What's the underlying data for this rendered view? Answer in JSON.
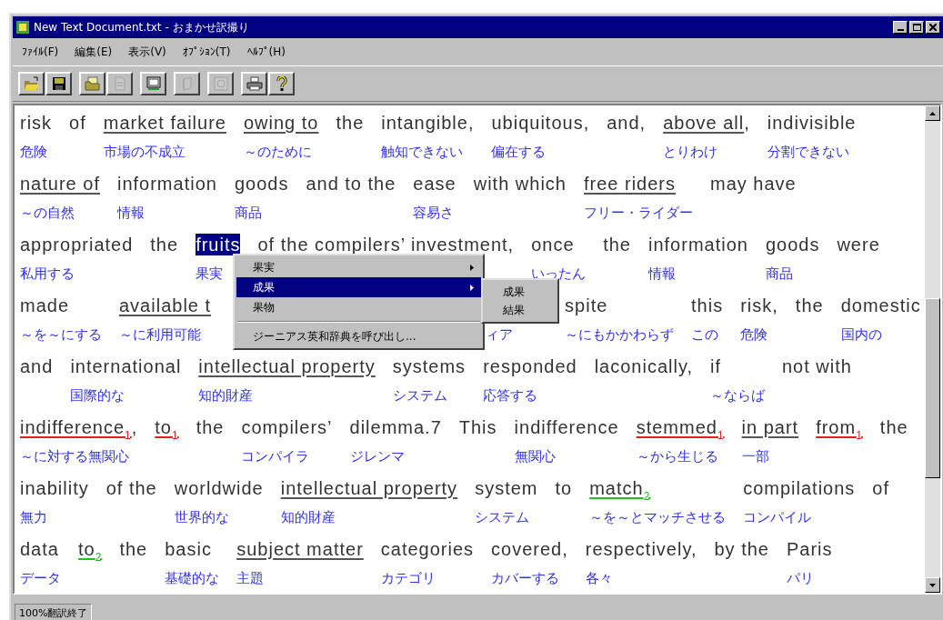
{
  "window": {
    "title": "New Text Document.txt - おまかせ訳撮り"
  },
  "menu": [
    "ﾌｧｲﾙ(F)",
    "編集(E)",
    "表示(V)",
    "ｵﾌﾟｼｮﾝ(T)",
    "ﾍﾙﾌﾟ(H)"
  ],
  "toolbar": [
    [
      {
        "kind": "open",
        "disabled": false
      },
      {
        "kind": "save",
        "disabled": false
      }
    ],
    [
      {
        "kind": "folder",
        "disabled": false
      },
      {
        "kind": "document",
        "disabled": true
      }
    ],
    [
      {
        "kind": "monitor",
        "disabled": false
      }
    ],
    [
      {
        "kind": "book",
        "disabled": true
      }
    ],
    [
      {
        "kind": "disc",
        "disabled": true
      }
    ],
    [
      {
        "kind": "printer",
        "disabled": false
      },
      {
        "kind": "help",
        "disabled": false
      }
    ]
  ],
  "lines": [
    [
      {
        "text": "risk",
        "gloss": "危険"
      },
      {
        "text": "of"
      },
      {
        "text": "market failure",
        "kind": "underline",
        "gloss": "市場の不成立"
      },
      {
        "text": "owing to",
        "kind": "underline",
        "gloss": "～のために"
      },
      {
        "text": "the"
      },
      {
        "text": "intangible,",
        "gloss": "触知できない"
      },
      {
        "text": "ubiquitous,",
        "gloss": "偏在する"
      },
      {
        "text": "and,"
      },
      {
        "text": "above all",
        "kind": "underline",
        "tail": ",",
        "gloss": "とりわけ"
      },
      {
        "text": "indivisible",
        "gloss": "分割できない"
      }
    ],
    [
      {
        "text": "nature of",
        "kind": "underline",
        "gloss": "～の自然"
      },
      {
        "text": "information",
        "gloss": "情報"
      },
      {
        "text": "goods",
        "gloss": "商品"
      },
      {
        "text": "and to the"
      },
      {
        "text": "ease",
        "gloss": "容易さ"
      },
      {
        "text": "with which"
      },
      {
        "text": "free riders",
        "kind": "underline",
        "gloss": "フリー・ライダー"
      },
      {
        "text": "may have"
      }
    ],
    [
      {
        "text": "appropriated",
        "gloss": "私用する"
      },
      {
        "text": "the"
      },
      {
        "text": "fruits",
        "kind": "selected",
        "gloss": "果実"
      },
      {
        "text": "of the compilers’ investment,"
      },
      {
        "text": "once",
        "gloss": "いったん"
      },
      {
        "text": "the"
      },
      {
        "text": "information",
        "gloss": "情報"
      },
      {
        "text": "goods",
        "gloss": "商品"
      },
      {
        "text": "were"
      }
    ],
    [
      {
        "text": "made",
        "gloss": "～を～にする"
      },
      {
        "text": "available t",
        "kind": "underline",
        "gloss": "～に利用可能"
      },
      {
        "gloss": "ィア"
      },
      {
        "text": "spite",
        "gloss": "～にもかかわらず"
      },
      {
        "text": "this",
        "gloss": "この"
      },
      {
        "text": "risk,",
        "gloss": "危険"
      },
      {
        "text": "the"
      },
      {
        "text": "domestic",
        "gloss": "国内の"
      }
    ],
    [
      {
        "text": "and"
      },
      {
        "text": "international",
        "gloss": "国際的な"
      },
      {
        "text": "intellectual property",
        "kind": "underline",
        "gloss": "知的財産"
      },
      {
        "text": "systems",
        "gloss": "システム"
      },
      {
        "text": "responded",
        "gloss": "応答する"
      },
      {
        "text": "laconically,"
      },
      {
        "text": "if",
        "gloss": "～ならば"
      },
      {
        "text": "not with"
      }
    ],
    [
      {
        "text": "indifference",
        "kind": "error",
        "mark": "1",
        "tail": ",",
        "gloss": "～に対する無関心"
      },
      {
        "text": "to",
        "kind": "error",
        "mark": "1"
      },
      {
        "text": "the"
      },
      {
        "text": "compilers’",
        "gloss": "コンパイラ"
      },
      {
        "text": "dilemma.7",
        "gloss": "ジレンマ"
      },
      {
        "text": "This"
      },
      {
        "text": "indifference",
        "gloss": "無関心"
      },
      {
        "text": "stemmed",
        "kind": "error",
        "mark": "1",
        "gloss": "～から生じる"
      },
      {
        "text": "in part",
        "kind": "underline",
        "gloss": "一部"
      },
      {
        "text": "from",
        "kind": "error",
        "mark": "1"
      },
      {
        "text": "the"
      }
    ],
    [
      {
        "text": "inability",
        "gloss": "無力"
      },
      {
        "text": "of the"
      },
      {
        "text": "worldwide",
        "gloss": "世界的な"
      },
      {
        "text": "intellectual property",
        "kind": "underline",
        "gloss": "知的財産"
      },
      {
        "text": "system",
        "gloss": "システム"
      },
      {
        "text": "to"
      },
      {
        "text": "match",
        "kind": "alternative",
        "mark": "2",
        "gloss": "～を～とマッチさせる"
      },
      {
        "text": "compilations",
        "gloss": "コンパイル"
      },
      {
        "text": "of"
      }
    ],
    [
      {
        "text": "data",
        "gloss": "データ"
      },
      {
        "text": "to",
        "kind": "alternative",
        "mark": "2"
      },
      {
        "text": "the"
      },
      {
        "text": "basic",
        "gloss": "基礎的な"
      },
      {
        "text": "subject matter",
        "kind": "underline",
        "gloss": "主題"
      },
      {
        "text": "categories",
        "gloss": "カテゴリ"
      },
      {
        "text": "covered,",
        "gloss": "カバーする"
      },
      {
        "text": "respectively,",
        "gloss": "各々"
      },
      {
        "text": "by the"
      },
      {
        "text": "Paris",
        "gloss": "パリ"
      }
    ]
  ],
  "context_menu": {
    "items": [
      {
        "kind": "item",
        "label": "果実",
        "submenu": true,
        "selected": false
      },
      {
        "kind": "item",
        "label": "成果",
        "submenu": true,
        "selected": true
      },
      {
        "kind": "item",
        "label": "果物",
        "submenu": false,
        "selected": false
      },
      {
        "kind": "separator"
      },
      {
        "kind": "item",
        "label": "ジーニアス英和辞典を呼び出し...",
        "submenu": false,
        "selected": false
      }
    ],
    "submenu": [
      {
        "label": "成果",
        "selected": false
      },
      {
        "label": "結果",
        "selected": false
      }
    ]
  },
  "status_bar": "100%翻訳終了"
}
